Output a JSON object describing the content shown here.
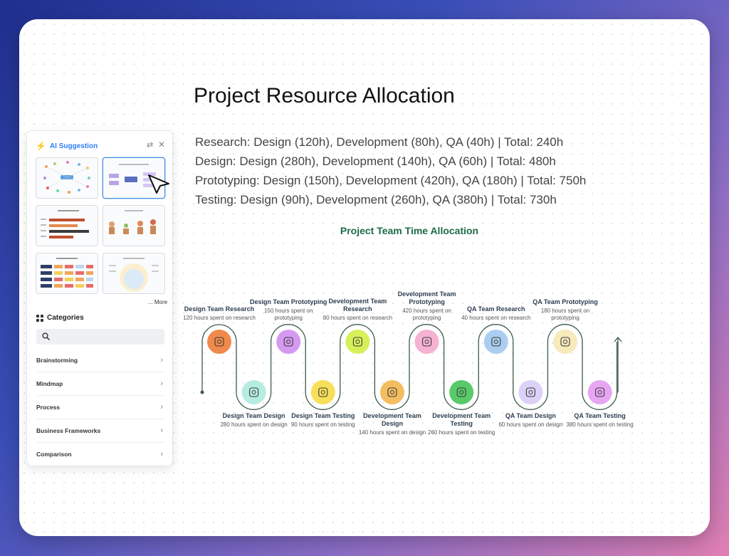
{
  "document": {
    "title": "Project Resource Allocation",
    "summary": [
      "Research: Design (120h), Development (80h), QA (40h) | Total: 240h",
      "Design: Design (280h), Development (140h), QA (60h) | Total: 480h",
      "Prototyping: Design (150h), Development (420h), QA (180h) | Total: 750h",
      "Testing: Design (90h), Development (260h), QA (380h) | Total: 730h"
    ]
  },
  "chart_data": {
    "type": "timeline",
    "title": "Project Team Time Allocation",
    "steps": [
      {
        "name": "Design Team Research",
        "desc": "120 hours spent on research",
        "hours": 120,
        "color": "#ef8a4c",
        "icon": "target-icon"
      },
      {
        "name": "Design Team Design",
        "desc": "280 hours spent on design",
        "hours": 280,
        "color": "#b6ece1",
        "icon": "growth-arrow-icon"
      },
      {
        "name": "Design Team Prototyping",
        "desc": "150 hours spent on prototyping",
        "hours": 150,
        "color": "#d59af0",
        "icon": "prototype-kit-icon"
      },
      {
        "name": "Design Team Testing",
        "desc": "90 hours spent on testing",
        "hours": 90,
        "color": "#f8df5a",
        "icon": "person-search-icon"
      },
      {
        "name": "Development Team Research",
        "desc": "80 hours spent on research",
        "hours": 80,
        "color": "#d7f05a",
        "icon": "team-chart-icon"
      },
      {
        "name": "Development Team Design",
        "desc": "140 hours spent on design",
        "hours": 140,
        "color": "#f3be62",
        "icon": "network-person-icon"
      },
      {
        "name": "Development Team Prototyping",
        "desc": "420 hours spent on prototyping",
        "hours": 420,
        "color": "#f6b2d2",
        "icon": "screen-person-icon"
      },
      {
        "name": "Development Team Testing",
        "desc": "260 hours spent on testing",
        "hours": 260,
        "color": "#59c96a",
        "icon": "monitor-gear-icon"
      },
      {
        "name": "QA Team Research",
        "desc": "40 hours spent on research",
        "hours": 40,
        "color": "#abcdef",
        "icon": "users-icon"
      },
      {
        "name": "QA Team Design",
        "desc": "60 hours spent on design",
        "hours": 60,
        "color": "#dcd1f7",
        "icon": "document-qt-icon"
      },
      {
        "name": "QA Team Prototyping",
        "desc": "180 hours spent on prototyping",
        "hours": 180,
        "color": "#f7eabb",
        "icon": "server-icon"
      },
      {
        "name": "QA Team Testing",
        "desc": "380 hours spent on testing",
        "hours": 380,
        "color": "#e7a6f2",
        "icon": "checklist-icon"
      }
    ]
  },
  "ai_panel": {
    "title": "AI Suggestion",
    "more_label": "... More",
    "categories_title": "Categories",
    "search_placeholder": "",
    "categories": [
      "Brainstorming",
      "Mindmap",
      "Process",
      "Business Frameworks",
      "Comparison"
    ],
    "accent_color": "#2f7cf6"
  }
}
